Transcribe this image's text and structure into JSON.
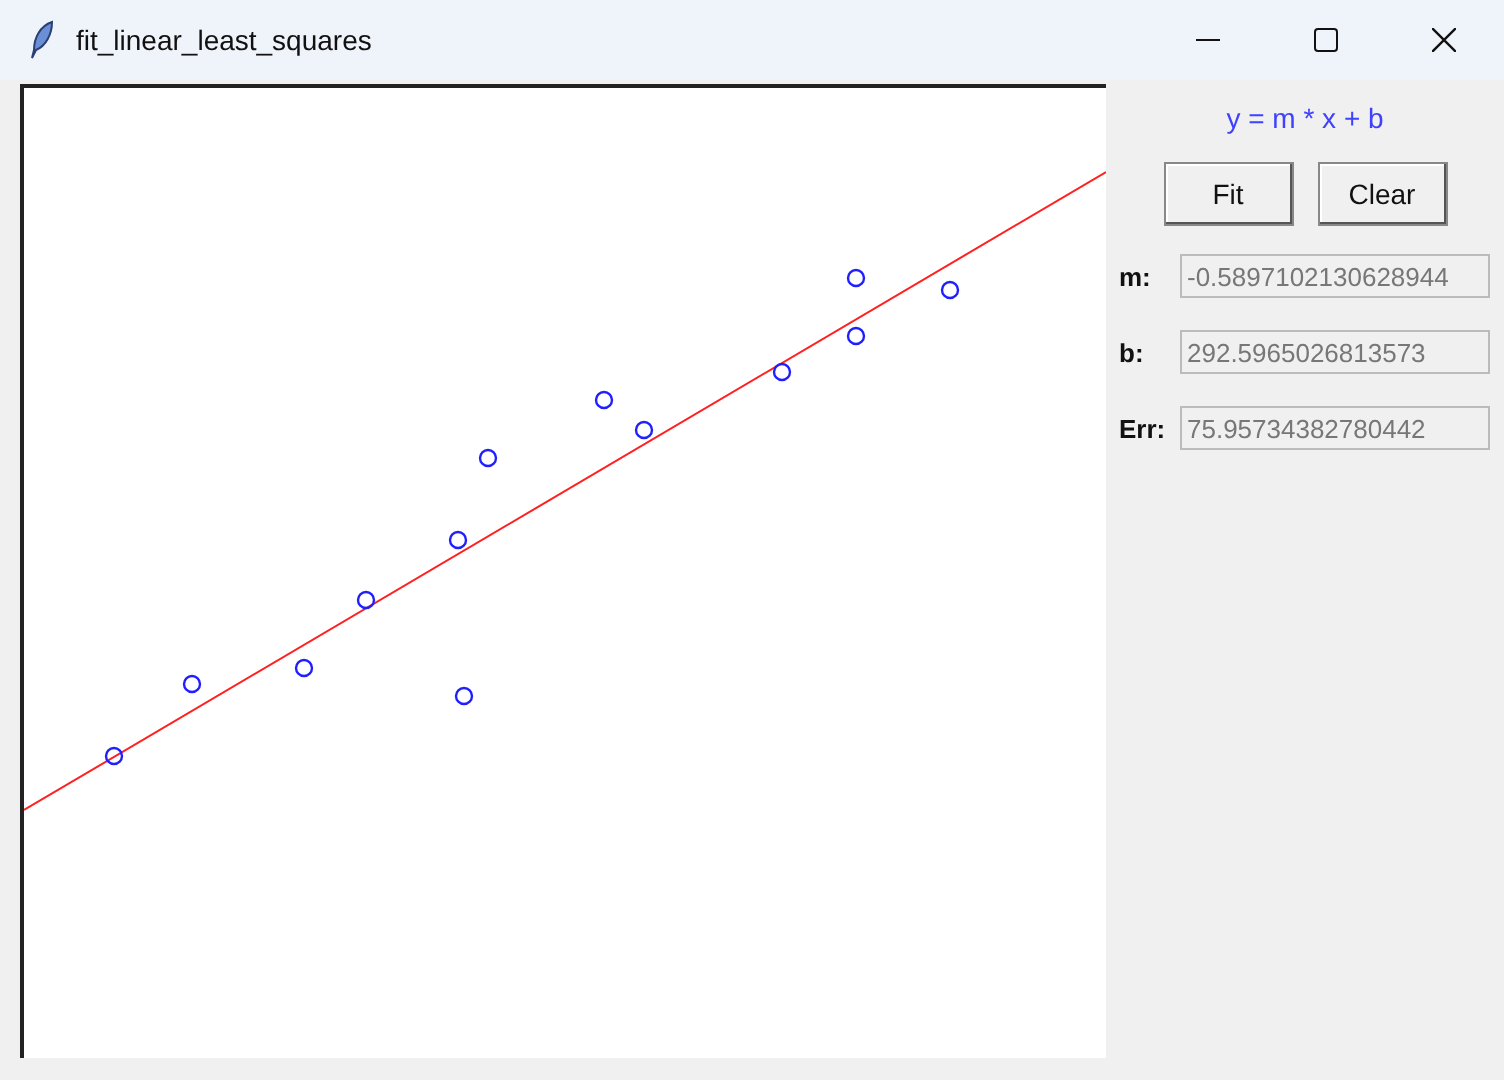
{
  "window": {
    "title": "fit_linear_least_squares"
  },
  "formula": "y = m * x + b",
  "buttons": [
    "Fit",
    "Clear"
  ],
  "fields": [
    {
      "label": "m:",
      "value": "-0.5897102130628944"
    },
    {
      "label": "b:",
      "value": "292.5965026813573"
    },
    {
      "label": "Err:",
      "value": "75.95734382780442"
    }
  ]
}
